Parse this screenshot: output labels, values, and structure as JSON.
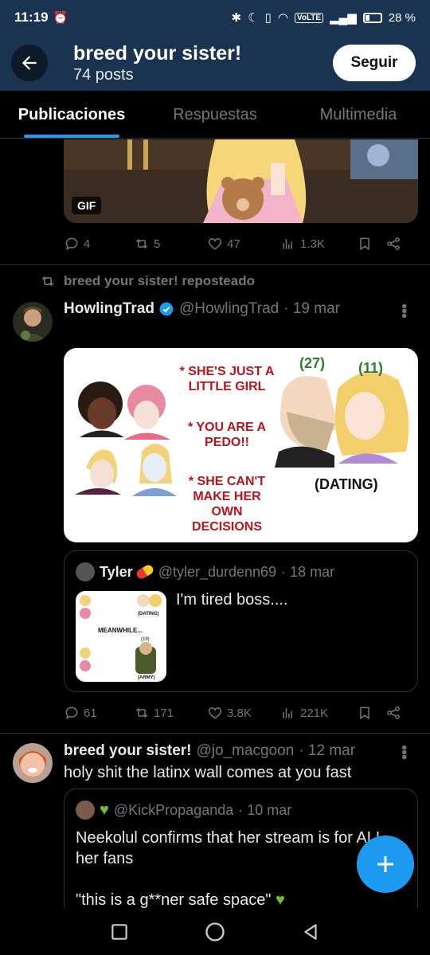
{
  "status_bar": {
    "time": "11:19",
    "network": "VoLTE",
    "battery": "28 %"
  },
  "header": {
    "title": "breed your sister!",
    "posts": "74 posts",
    "follow_label": "Seguir"
  },
  "tabs": [
    {
      "label": "Publicaciones",
      "active": true
    },
    {
      "label": "Respuestas",
      "active": false
    },
    {
      "label": "Multimedia",
      "active": false
    }
  ],
  "post1": {
    "gif_badge": "GIF",
    "stats": {
      "replies": "4",
      "reposts": "5",
      "likes": "47",
      "views": "1.3K"
    }
  },
  "post2": {
    "repost_label": "breed your sister! reposteado",
    "author": "HowlingTrad",
    "handle": "@HowlingTrad",
    "date": "· 19 mar",
    "meme": {
      "left_text_1": "* SHE'S JUST A LITTLE GIRL",
      "left_text_2": "* YOU ARE A PEDO!!",
      "left_text_3": "* SHE CAN'T MAKE HER OWN DECISIONS",
      "age_left": "(27)",
      "age_right": "(11)",
      "caption": "(DATING)"
    },
    "quote": {
      "author": "Tyler",
      "handle": "@tyler_durdenn69",
      "date": "· 18 mar",
      "text": "I'm tired boss....",
      "thumb_text_1": "MEANWHILE...",
      "thumb_age": "(19)",
      "thumb_left_1": "(DATING)",
      "thumb_left_2": "(ARMY)"
    },
    "stats": {
      "replies": "61",
      "reposts": "171",
      "likes": "3.8K",
      "views": "221K"
    }
  },
  "post3": {
    "author": "breed your sister!",
    "handle": "@jo_macgoon",
    "date": "· 12 mar",
    "text": "holy shit the latinx wall comes at you fast",
    "quote": {
      "handle": "@KickPropaganda",
      "date": "· 10 mar",
      "text_1": "Neekolul confirms that her stream is for ALL her fans",
      "text_2": "\"this is a g**ner safe space\""
    }
  },
  "colors": {
    "accent": "#1d9bf0",
    "header_bg": "#1a3350",
    "muted": "#71767b",
    "verified": "#1d9bf0"
  }
}
